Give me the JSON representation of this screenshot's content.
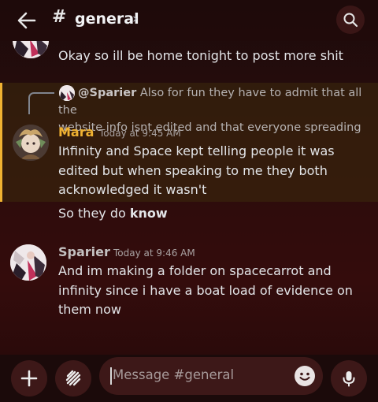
{
  "header": {
    "hash": "#",
    "channel": "general",
    "chevron": "›",
    "back_icon": "arrow-left-icon",
    "search_icon": "search-icon"
  },
  "messages": {
    "top_continuation": "Okay so ill be home tonight to post more shit",
    "reply": {
      "mention": "@Sparier",
      "line1": "Also for fun they have to admit that all the",
      "line2": "website info isnt edited and that everyone spreading ..."
    },
    "mara": {
      "author": "Mara",
      "time": "Today at 9:45 AM",
      "line1": "Infinity and Space kept telling people it was",
      "line2": "edited but when speaking to me they both",
      "line3": "acknowledged it wasn't",
      "followup_prefix": "So they do ",
      "followup_bold": "know"
    },
    "sparier": {
      "author": "Sparier",
      "time": "Today at 9:46 AM",
      "line1": "And im making a folder on spacecarrot and",
      "line2": "infinity since i have a boat load of evidence on",
      "line3": "them now"
    }
  },
  "composer": {
    "placeholder": "Message #general",
    "add_icon": "plus-icon",
    "apps_icon": "apps-icon",
    "emoji_icon": "emoji-icon",
    "mic_icon": "microphone-icon"
  },
  "colors": {
    "mara_name": "#f0b232",
    "highlight_border": "#f0b232",
    "sparier_name": "#c4c1c1"
  }
}
